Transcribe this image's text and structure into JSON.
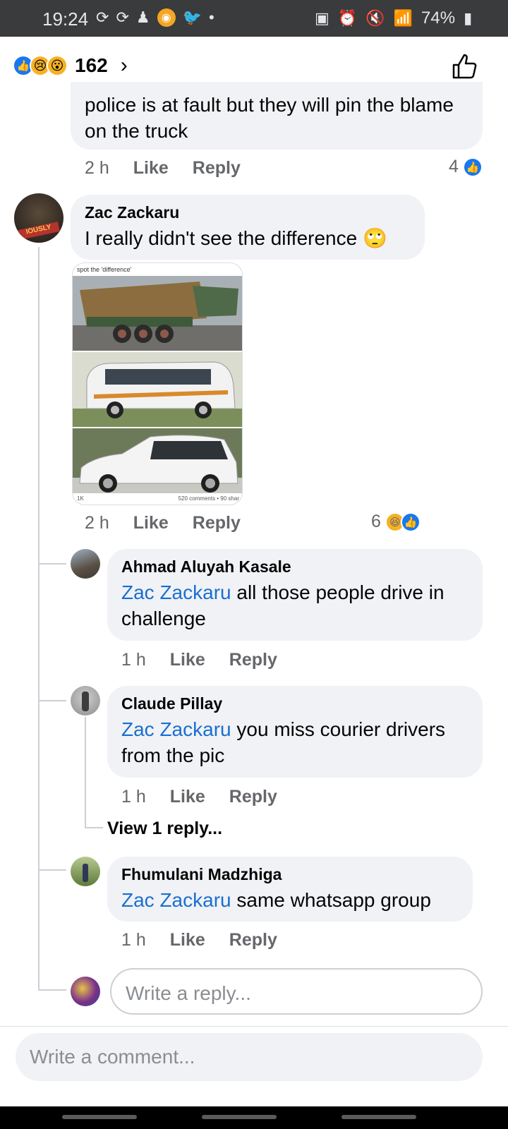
{
  "status_bar": {
    "time": "19:24",
    "battery": "74%"
  },
  "header": {
    "reaction_count": "162",
    "chevron": "›"
  },
  "comments": [
    {
      "id": "top-partial",
      "text": "police is at fault but they will pin the blame on the truck",
      "time": "2 h",
      "like": "Like",
      "reply": "Reply",
      "reaction_count": "4"
    },
    {
      "id": "zac",
      "author": "Zac Zackaru",
      "text": "I really didn't see the difference 🙄",
      "time": "2 h",
      "like": "Like",
      "reply": "Reply",
      "reaction_count": "6",
      "image": {
        "caption": "spot the 'difference'",
        "footer_left": "1K",
        "footer_right": "520 comments • 90 shar"
      }
    },
    {
      "id": "ahmad",
      "author": "Ahmad Aluyah Kasale",
      "mention": "Zac Zackaru",
      "text": " all those people drive in challenge",
      "time": "1 h",
      "like": "Like",
      "reply": "Reply"
    },
    {
      "id": "claude",
      "author": "Claude Pillay",
      "mention": "Zac Zackaru",
      "text": " you miss courier drivers from the pic",
      "time": "1 h",
      "like": "Like",
      "reply": "Reply",
      "view_replies": "View 1 reply..."
    },
    {
      "id": "fhumulani",
      "author": "Fhumulani Madzhiga",
      "mention": "Zac Zackaru",
      "text": " same whatsapp group",
      "time": "1 h",
      "like": "Like",
      "reply": "Reply"
    }
  ],
  "reply_placeholder": "Write a reply...",
  "comment_placeholder": "Write a comment...",
  "colors": {
    "accent": "#1877f2",
    "mention": "#1a6fd1",
    "bubble": "#f0f2f5",
    "muted": "#65676b"
  }
}
